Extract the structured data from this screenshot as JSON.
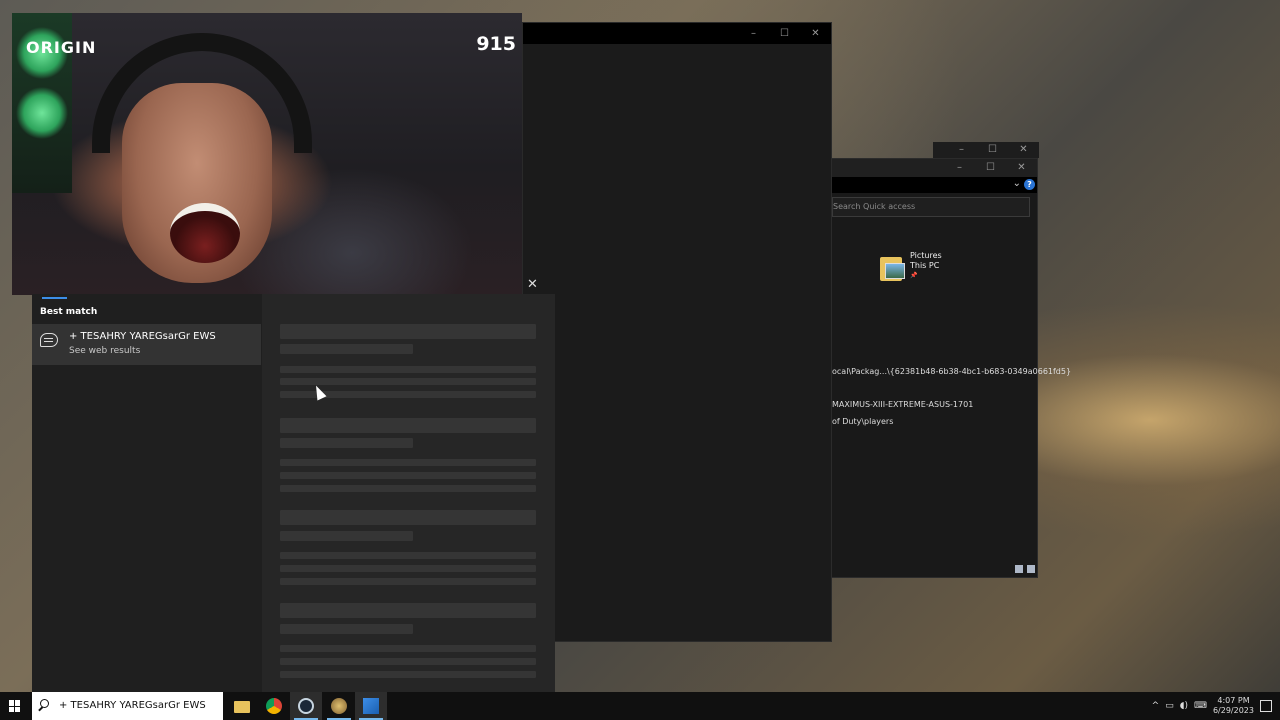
{
  "stream": {
    "logo": "ORIGIN",
    "counter": "915"
  },
  "black_window": {
    "controls": {
      "minimize": "–",
      "maximize": "☐",
      "close": "✕"
    }
  },
  "explorer": {
    "controls": {
      "minimize": "–",
      "maximize": "☐",
      "close": "✕"
    },
    "search_placeholder": "Search Quick access",
    "folder": {
      "name": "Pictures",
      "location": "This PC",
      "pin": "📌"
    },
    "paths": [
      "ocal\\Packag...\\{62381b48-6b38-4bc1-b683-0349a0661fd5}",
      "MAXIMUS-XIII-EXTREME-ASUS-1701",
      "of Duty\\players"
    ]
  },
  "search_panel": {
    "section_label": "Best match",
    "result": {
      "title": "+ TESAHRY YAREGsarGr EWS",
      "subtitle": "See web results"
    },
    "close": "✕"
  },
  "taskbar": {
    "search_value": "+ TESAHRY YAREGsarGr EWS",
    "apps": [
      "file-explorer",
      "chrome",
      "steam",
      "game",
      "active-app"
    ],
    "tray": {
      "chevron": "^",
      "time": "4:07 PM",
      "date": "6/29/2023"
    }
  },
  "colors": {
    "accent": "#3c8ee8",
    "taskbar": "#101010",
    "panel": "#1f1f1f"
  }
}
